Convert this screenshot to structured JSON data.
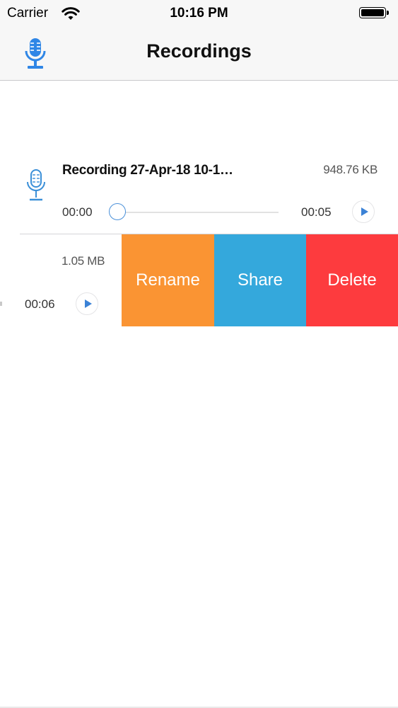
{
  "status_bar": {
    "carrier": "Carrier",
    "time": "10:16 PM"
  },
  "nav": {
    "title": "Recordings",
    "icon": "microphone-icon"
  },
  "recordings": [
    {
      "title": "Recording 27-Apr-18 10-1…",
      "size": "948.76 KB",
      "elapsed": "00:00",
      "duration": "00:05",
      "progress": 0
    },
    {
      "size": "1.05 MB",
      "duration": "00:06"
    }
  ],
  "swipe_actions": {
    "rename": "Rename",
    "share": "Share",
    "delete": "Delete"
  },
  "colors": {
    "accent_blue": "#3b82d6",
    "rename": "#fa9433",
    "share": "#34a8dc",
    "delete": "#fd3b3e"
  }
}
